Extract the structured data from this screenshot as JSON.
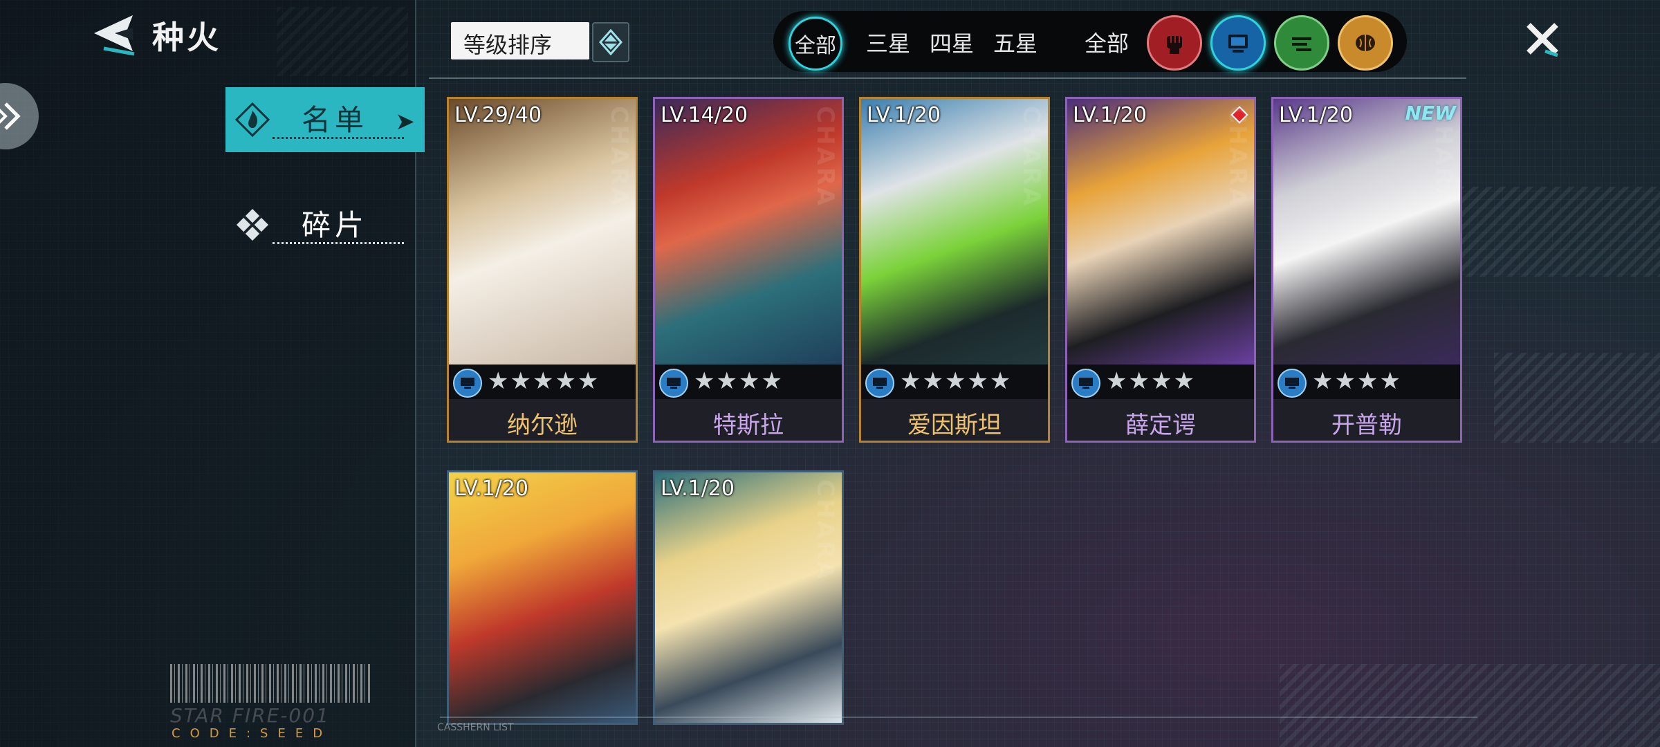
{
  "header": {
    "title": "种火"
  },
  "side_tabs": [
    {
      "label": "名单",
      "active": true
    },
    {
      "label": "碎片",
      "active": false
    }
  ],
  "sort": {
    "label": "等级排序"
  },
  "filters": {
    "star_tabs": [
      "全部",
      "三星",
      "四星",
      "五星"
    ],
    "class_all": "全部",
    "class_icons": [
      "fist-icon",
      "chip-icon",
      "circuit-icon",
      "brain-icon"
    ],
    "active_class": "chip-icon"
  },
  "cards": [
    {
      "level": "LV.29/40",
      "name": "纳尔逊",
      "stars": "★★★★★",
      "rarity": "gold",
      "badge": ""
    },
    {
      "level": "LV.14/20",
      "name": "特斯拉",
      "stars": "★★★★",
      "rarity": "purple",
      "badge": ""
    },
    {
      "level": "LV.1/20",
      "name": "爱因斯坦",
      "stars": "★★★★★",
      "rarity": "gold",
      "badge": ""
    },
    {
      "level": "LV.1/20",
      "name": "薛定谔",
      "stars": "★★★★",
      "rarity": "purple",
      "badge": "red-dot"
    },
    {
      "level": "LV.1/20",
      "name": "开普勒",
      "stars": "★★★★",
      "rarity": "purple",
      "badge": "NEW"
    },
    {
      "level": "LV.1/20",
      "name": "",
      "stars": "",
      "rarity": "purple",
      "badge": ""
    },
    {
      "level": "LV.1/20",
      "name": "",
      "stars": "",
      "rarity": "purple",
      "badge": ""
    }
  ],
  "decor": {
    "starfire": "STAR FIRE-001",
    "code": "CODE:SEED",
    "card_watermark": "CHARA",
    "list_tag": "CASSHERN LIST"
  },
  "colors": {
    "accent": "#2bb7c2",
    "gold": "#b7832f",
    "purple": "#8d62b7"
  }
}
